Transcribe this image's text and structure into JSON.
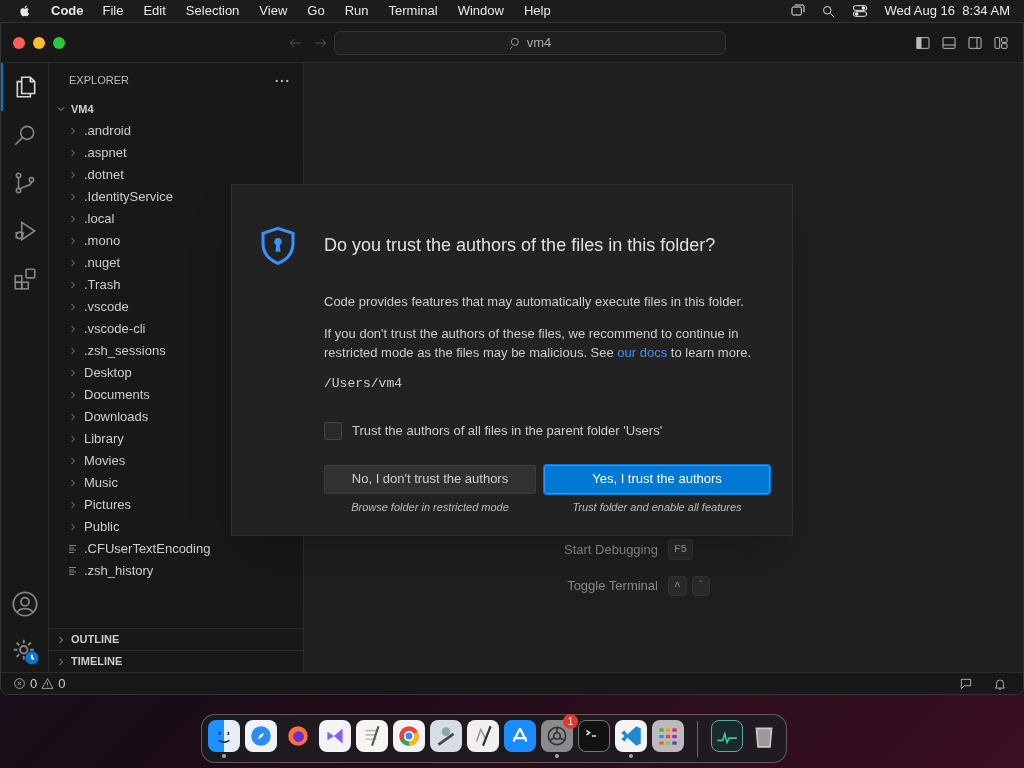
{
  "menubar": {
    "app": "Code",
    "menus": [
      "File",
      "Edit",
      "Selection",
      "View",
      "Go",
      "Run",
      "Terminal",
      "Window",
      "Help"
    ],
    "clock": "Wed Aug 16  8:34 AM"
  },
  "titlebar": {
    "search": "vm4"
  },
  "activity_bar": [
    {
      "kind": "files",
      "selected": true
    },
    {
      "kind": "search",
      "selected": false
    },
    {
      "kind": "source-control",
      "selected": false
    },
    {
      "kind": "debug",
      "selected": false
    },
    {
      "kind": "extensions",
      "selected": false
    }
  ],
  "explorer": {
    "title": "EXPLORER",
    "root": {
      "label": "VM4",
      "expanded": true,
      "children": [
        {
          "label": ".android",
          "kind": "folder"
        },
        {
          "label": ".aspnet",
          "kind": "folder"
        },
        {
          "label": ".dotnet",
          "kind": "folder"
        },
        {
          "label": ".IdentityService",
          "kind": "folder"
        },
        {
          "label": ".local",
          "kind": "folder"
        },
        {
          "label": ".mono",
          "kind": "folder"
        },
        {
          "label": ".nuget",
          "kind": "folder"
        },
        {
          "label": ".Trash",
          "kind": "folder"
        },
        {
          "label": ".vscode",
          "kind": "folder"
        },
        {
          "label": ".vscode-cli",
          "kind": "folder"
        },
        {
          "label": ".zsh_sessions",
          "kind": "folder"
        },
        {
          "label": "Desktop",
          "kind": "folder"
        },
        {
          "label": "Documents",
          "kind": "folder"
        },
        {
          "label": "Downloads",
          "kind": "folder"
        },
        {
          "label": "Library",
          "kind": "folder"
        },
        {
          "label": "Movies",
          "kind": "folder"
        },
        {
          "label": "Music",
          "kind": "folder"
        },
        {
          "label": "Pictures",
          "kind": "folder"
        },
        {
          "label": "Public",
          "kind": "folder"
        },
        {
          "label": ".CFUserTextEncoding",
          "kind": "file"
        },
        {
          "label": ".zsh_history",
          "kind": "file"
        }
      ]
    },
    "sections": [
      {
        "label": "OUTLINE",
        "expanded": false
      },
      {
        "label": "TIMELINE",
        "expanded": false
      }
    ]
  },
  "editor": {
    "shortcuts": [
      {
        "label": "Start Debugging",
        "keys": [
          "F5"
        ]
      },
      {
        "label": "Toggle Terminal",
        "keys": [
          "^",
          "`"
        ]
      }
    ]
  },
  "dialog": {
    "title": "Do you trust the authors of the files in this folder?",
    "text_1": "Code provides features that may automatically execute files in this folder.",
    "text_2": "If you don't trust the authors of these files, we recommend to continue in restricted mode as the files may be malicious. See",
    "link": "our docs",
    "text_3": "to learn more.",
    "path": "/Users/vm4",
    "checkbox": {
      "label": "Trust the authors of all files in the parent folder 'Users'",
      "checked": false
    },
    "buttons": [
      {
        "label": "No, I don't trust the authors",
        "caption": "Browse folder in restricted mode",
        "primary": false
      },
      {
        "label": "Yes, I trust the authors",
        "caption": "Trust folder and enable all features",
        "primary": true
      }
    ]
  },
  "status_bar": {
    "errors": "0",
    "warnings": "0"
  },
  "dock": [
    {
      "kind": "finder",
      "running": true
    },
    {
      "kind": "safari",
      "running": false
    },
    {
      "kind": "firefox",
      "running": false
    },
    {
      "kind": "visual-studio",
      "running": false
    },
    {
      "kind": "textedit",
      "running": false
    },
    {
      "kind": "chrome",
      "running": false
    },
    {
      "kind": "utility",
      "running": false
    },
    {
      "kind": "script-editor",
      "running": false
    },
    {
      "kind": "app-store",
      "running": false
    },
    {
      "kind": "settings",
      "running": true,
      "badge": "1"
    },
    {
      "kind": "terminal",
      "running": false
    },
    {
      "kind": "vscode",
      "running": true
    },
    {
      "kind": "launchpad",
      "running": false
    },
    {
      "kind": "separator"
    },
    {
      "kind": "activity-monitor",
      "running": false
    },
    {
      "kind": "trash",
      "running": false
    }
  ]
}
